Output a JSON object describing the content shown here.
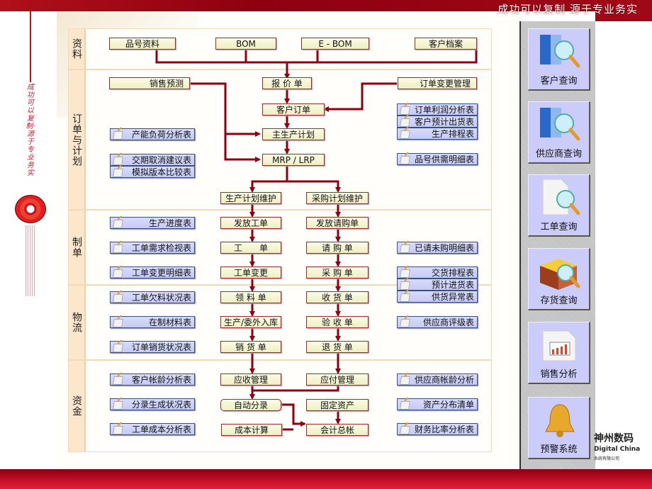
{
  "header": {
    "slogan": "成功可以复制  源于专业务实"
  },
  "left_decoration": {
    "vertical_text": "成功可以复制·源于专业务实"
  },
  "colors": {
    "accent_red": "#8e0010",
    "node_border": "#9b2a2a",
    "report_border": "#3a4f86",
    "report_fill": "#c6cbf5",
    "node_fill": "#efeec2",
    "lane_label_bg": "#fce6cc"
  },
  "lanes": [
    {
      "label": "资料"
    },
    {
      "label": "订单与计划"
    },
    {
      "label": "制单"
    },
    {
      "label": "物流"
    },
    {
      "label": "资金"
    }
  ],
  "nodes": {
    "item_data": "品号资料",
    "bom": "BOM",
    "ebom": "E - BOM",
    "customer_file": "客户档案",
    "sales_forecast": "销售预测",
    "quotation": "报 价 单",
    "order_change_mgmt": "订单变更管理",
    "customer_order": "客户订单",
    "mps": "主生产计划",
    "mrp": "MRP / LRP",
    "prod_plan_maint": "生产计划维护",
    "purch_plan_maint": "采购计划维护",
    "issue_work_order": "发放工单",
    "issue_purch_req": "发放请购单",
    "work_order": "工　　单",
    "purch_req": "请 购 单",
    "work_order_change": "工单变更",
    "purchase_order": "采 购 单",
    "material_requisition": "领 料 单",
    "goods_receipt": "收 货 单",
    "prod_stock_in": "生产/委外入库",
    "inspection": "验 收 单",
    "sales_delivery": "销 货 单",
    "goods_return": "退 货 单",
    "ar_mgmt": "应收管理",
    "ap_mgmt": "应付管理",
    "auto_voucher": "自动分录",
    "fixed_assets": "固定资产",
    "cost_calc": "成本计算",
    "general_ledger": "会计总帐"
  },
  "reports_left": [
    "产能负荷分析表",
    "交期取消建议表",
    "模拟版本比较表",
    "生产进度表",
    "工单需求检视表",
    "工单变更明细表",
    "工单欠料状况表",
    "在制材料表",
    "订单销货状况表",
    "客户帐龄分析表",
    "分录生成状况表",
    "工单成本分析表"
  ],
  "reports_right": [
    "订单利润分析表",
    "客户预计出货表",
    "生产排程表",
    "品号供需明细表",
    "已请未购明细表",
    "交货排程表",
    "预计进货表",
    "供货异常表",
    "供应商评级表",
    "供应商帐龄分析",
    "资产分布清单",
    "财务比率分析表"
  ],
  "side_panel": [
    {
      "label": "客户查询",
      "icon": "finder-magnifier-icon"
    },
    {
      "label": "供应商查询",
      "icon": "finder-magnifier-icon"
    },
    {
      "label": "工单查询",
      "icon": "document-magnifier-icon"
    },
    {
      "label": "存货查询",
      "icon": "box-magnifier-icon"
    },
    {
      "label": "销售分析",
      "icon": "bar-chart-document-icon"
    },
    {
      "label": "预警系统",
      "icon": "bell-icon"
    }
  ],
  "logo": {
    "cn": "神州数码",
    "en": "Digital China",
    "sub": "系统有限公司"
  }
}
